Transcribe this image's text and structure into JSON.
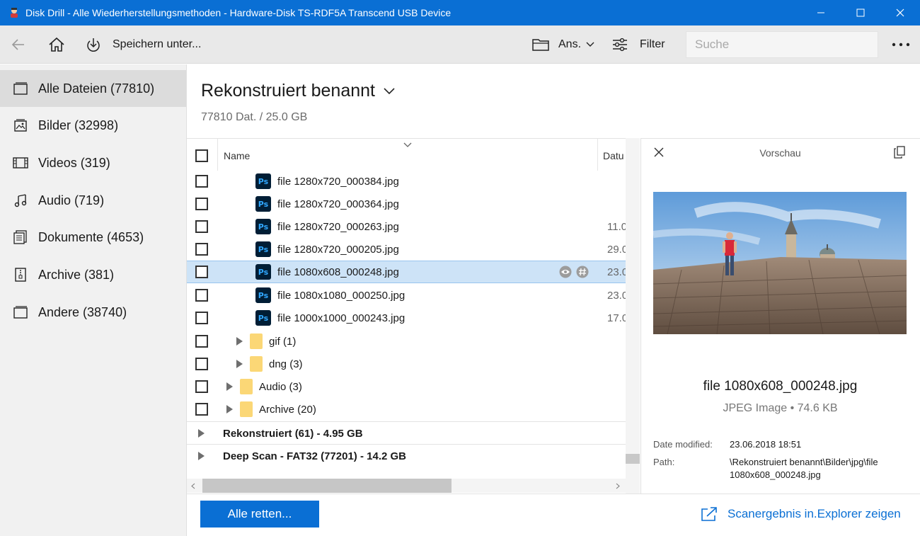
{
  "window": {
    "title": "Disk Drill - Alle Wiederherstellungsmethoden - Hardware-Disk TS-RDF5A Transcend USB Device"
  },
  "toolbar": {
    "save_label": "Speichern unter...",
    "view_label": "Ans.",
    "filter_label": "Filter",
    "search_placeholder": "Suche"
  },
  "sidebar": {
    "items": [
      {
        "label": "Alle Dateien (77810)",
        "icon": "all-files-icon"
      },
      {
        "label": "Bilder (32998)",
        "icon": "images-icon"
      },
      {
        "label": "Videos (319)",
        "icon": "video-icon"
      },
      {
        "label": "Audio (719)",
        "icon": "music-note-icon"
      },
      {
        "label": "Dokumente (4653)",
        "icon": "document-icon"
      },
      {
        "label": "Archive (381)",
        "icon": "archive-icon"
      },
      {
        "label": "Andere (38740)",
        "icon": "other-files-icon"
      }
    ]
  },
  "main": {
    "title": "Rekonstruiert benannt",
    "subtitle": "77810 Dat. / 25.0 GB"
  },
  "list": {
    "columns": {
      "name": "Name",
      "date": "Datu"
    },
    "rows": [
      {
        "name": "file 1280x720_000384.jpg",
        "date": ""
      },
      {
        "name": "file 1280x720_000364.jpg",
        "date": ""
      },
      {
        "name": "file 1280x720_000263.jpg",
        "date": "11.0"
      },
      {
        "name": "file 1280x720_000205.jpg",
        "date": "29.0"
      },
      {
        "name": "file 1080x608_000248.jpg",
        "date": "23.0"
      },
      {
        "name": "file 1080x1080_000250.jpg",
        "date": "23.0"
      },
      {
        "name": "file 1000x1000_000243.jpg",
        "date": "17.0"
      }
    ],
    "folders": [
      {
        "name": "gif (1)"
      },
      {
        "name": "dng (3)"
      },
      {
        "name": "Audio (3)"
      },
      {
        "name": "Archive (20)"
      }
    ],
    "groups": [
      {
        "label": "Rekonstruiert (61) - 4.95 GB"
      },
      {
        "label": "Deep Scan - FAT32 (77201) - 14.2 GB"
      }
    ]
  },
  "preview": {
    "title": "Vorschau",
    "file_name": "file 1080x608_000248.jpg",
    "file_type": "JPEG Image • 74.6 KB",
    "date_label": "Date modified:",
    "date_value": "23.06.2018 18:51",
    "path_label": "Path:",
    "path_value": "\\Rekonstruiert benannt\\Bilder\\jpg\\file 1080x608_000248.jpg"
  },
  "bottom": {
    "recover_label": "Alle retten...",
    "explorer_label": "Scanergebnis in.Explorer zeigen"
  },
  "colors": {
    "accent": "#0a6fd4",
    "selection": "#cde3f7"
  }
}
